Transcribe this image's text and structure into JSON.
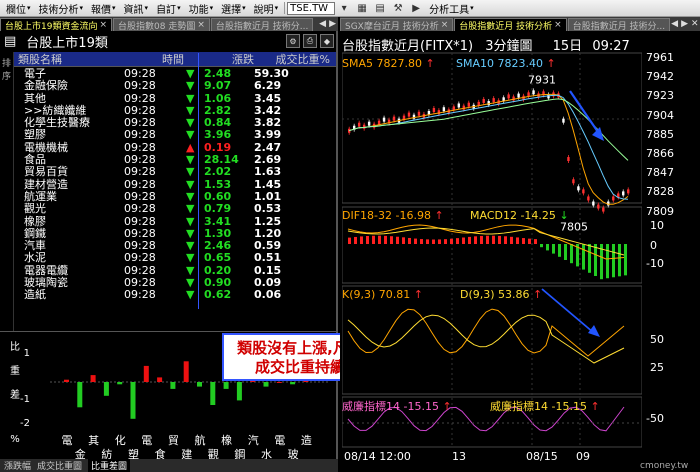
{
  "menubar": {
    "items": [
      "欄位",
      "技術分析",
      "報價",
      "資訊",
      "自訂",
      "功能",
      "選擇",
      "說明"
    ],
    "symbol_value": "TSE.TW",
    "analysis_tools": "分析工具"
  },
  "left_tabs": [
    "台股上市19類資金流向",
    "台股指數08 走勢圖",
    "台股指數近月 技術分..."
  ],
  "right_tabs": [
    "SGX摩台近月 技術分析",
    "台股指數近月 技術分析",
    "台股指數近月 技術分..."
  ],
  "left": {
    "title": "台股上市19類",
    "sidebar_label": "排序",
    "table": {
      "headers": [
        "類股名稱",
        "時間",
        "漲跌",
        "成交比重%"
      ],
      "rows": [
        {
          "name": "電子",
          "time": "09:28",
          "dir": "down",
          "chg": "2.48",
          "wt": "59.30"
        },
        {
          "name": "金融保險",
          "time": "09:28",
          "dir": "down",
          "chg": "9.07",
          "wt": "6.29"
        },
        {
          "name": "其他",
          "time": "09:28",
          "dir": "down",
          "chg": "1.06",
          "wt": "3.45"
        },
        {
          "name": ">>紡織纖維",
          "time": "09:28",
          "dir": "down",
          "chg": "2.82",
          "wt": "3.42"
        },
        {
          "name": "化學生技醫療",
          "time": "09:28",
          "dir": "down",
          "chg": "0.84",
          "wt": "3.82"
        },
        {
          "name": "塑膠",
          "time": "09:28",
          "dir": "down",
          "chg": "3.96",
          "wt": "3.99"
        },
        {
          "name": "電機機械",
          "time": "09:28",
          "dir": "up",
          "chg": "0.19",
          "wt": "2.47"
        },
        {
          "name": "食品",
          "time": "09:28",
          "dir": "down",
          "chg": "28.14",
          "wt": "2.69"
        },
        {
          "name": "貿易百貨",
          "time": "09:28",
          "dir": "down",
          "chg": "2.02",
          "wt": "1.63"
        },
        {
          "name": "建材營造",
          "time": "09:28",
          "dir": "down",
          "chg": "1.53",
          "wt": "1.45"
        },
        {
          "name": "航運業",
          "time": "09:28",
          "dir": "down",
          "chg": "0.60",
          "wt": "1.01"
        },
        {
          "name": "觀光",
          "time": "09:28",
          "dir": "down",
          "chg": "0.79",
          "wt": "0.53"
        },
        {
          "name": "橡膠",
          "time": "09:28",
          "dir": "down",
          "chg": "3.41",
          "wt": "1.25"
        },
        {
          "name": "鋼鐵",
          "time": "09:28",
          "dir": "down",
          "chg": "1.30",
          "wt": "1.20"
        },
        {
          "name": "汽車",
          "time": "09:28",
          "dir": "down",
          "chg": "2.46",
          "wt": "0.59"
        },
        {
          "name": "水泥",
          "time": "09:28",
          "dir": "down",
          "chg": "0.65",
          "wt": "0.51"
        },
        {
          "name": "電器電纜",
          "time": "09:28",
          "dir": "down",
          "chg": "0.20",
          "wt": "0.15"
        },
        {
          "name": "玻璃陶瓷",
          "time": "09:28",
          "dir": "down",
          "chg": "0.90",
          "wt": "0.09"
        },
        {
          "name": "造紙",
          "time": "09:28",
          "dir": "down",
          "chg": "0.62",
          "wt": "0.06"
        }
      ]
    },
    "mini_chart": {
      "y_label": [
        "比",
        "重",
        "差",
        "%"
      ],
      "ticks": [
        "1",
        "",
        "-1",
        "-2"
      ],
      "cat_row1": [
        "電",
        "其",
        "化",
        "電",
        "貿",
        "航",
        "橡",
        "汽",
        "電",
        "造"
      ],
      "cat_row2": [
        "金",
        "紡",
        "塑",
        "食",
        "建",
        "觀",
        "鋼",
        "水",
        "玻"
      ],
      "values": [
        0.1,
        -1.1,
        0.3,
        -0.6,
        -0.1,
        -1.6,
        0.7,
        0.2,
        -0.3,
        0.9,
        -0.2,
        -1.0,
        -0.3,
        -0.8,
        0.1,
        -0.2,
        0.0,
        -0.1,
        0.1
      ]
    },
    "bottom_tabs": [
      "漲跌幅",
      "成交比重圖",
      "比重差圖"
    ]
  },
  "callout": {
    "line1": "類股沒有上漲,凡而下跌",
    "line2": "成交比重持續增加"
  },
  "right": {
    "title": "台股指數近月(FITX*1)",
    "interval": "3分鐘圖",
    "day": "15日",
    "time": "09:27",
    "sma5": "SMA5 7827.80",
    "sma10": "SMA10 7823.40",
    "price_ticks": [
      "7961",
      "7942",
      "7923",
      "7904",
      "7885",
      "7866",
      "7847",
      "7828",
      "7809"
    ],
    "high_label": "7931",
    "low_label": "7805",
    "dif": "DIF18-32 -16.98",
    "macd": "MACD12 -14.25",
    "macd_ticks": [
      "10",
      "0",
      "-10"
    ],
    "k": "K(9,3) 70.81",
    "d": "D(9,3) 53.86",
    "kd_ticks": [
      "50",
      "25"
    ],
    "w1": "威廉指標14 -15.15",
    "w2": "威廉指標14 -15.15",
    "w_ticks": [
      "-50"
    ],
    "dates": [
      "08/14 12:00",
      "13",
      "08/15",
      "09"
    ],
    "watermark": "cmoney.tw"
  }
}
